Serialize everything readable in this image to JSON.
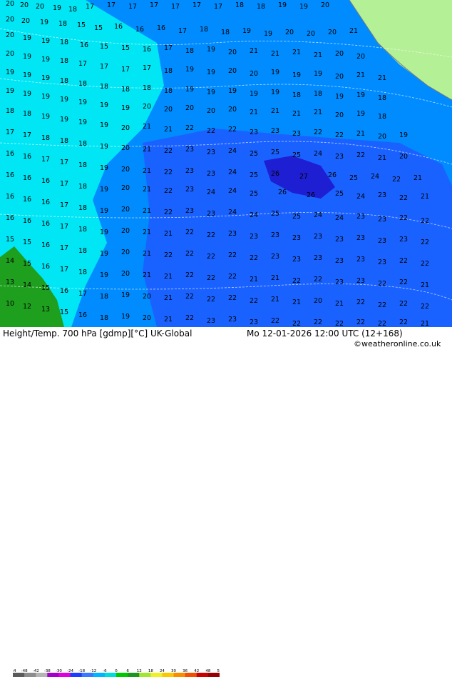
{
  "header": {
    "title": "Height/Temp. 700 hPa [gdmp][°C] UK-Global",
    "datetime": "Mo 12-01-2026 12:00 UTC (12+168)",
    "credit": "©weatheronline.co.uk"
  },
  "colorbar": {
    "ticks": [
      "-54",
      "-48",
      "-42",
      "-38",
      "-30",
      "-24",
      "-18",
      "-12",
      "-6",
      "0",
      "6",
      "12",
      "18",
      "24",
      "30",
      "36",
      "42",
      "48",
      "54"
    ],
    "colors": [
      "#5a5a5a",
      "#8c8c8c",
      "#b4b4b4",
      "#a000c8",
      "#dc00dc",
      "#1e3cff",
      "#3c78ff",
      "#00b4ff",
      "#00dcdc",
      "#00c800",
      "#1e961e",
      "#a0e632",
      "#f0f028",
      "#fac800",
      "#fa8c00",
      "#f05000",
      "#c80000",
      "#960000"
    ]
  },
  "map": {
    "colors": {
      "land_green": "#b4f096",
      "ocean_cyan": "#00e6f5",
      "mid_blue": "#008cff",
      "deep_blue": "#1e5aff",
      "core_blue": "#1e1ed2",
      "cold_green": "#1ea01e",
      "coast_gray": "#7a7a7a"
    },
    "labels": [
      [
        "20",
        8,
        8
      ],
      [
        "20",
        28,
        10
      ],
      [
        "20",
        50,
        12
      ],
      [
        "19",
        74,
        14
      ],
      [
        "18",
        96,
        16
      ],
      [
        "17",
        120,
        12
      ],
      [
        "17",
        150,
        10
      ],
      [
        "17",
        180,
        12
      ],
      [
        "17",
        210,
        10
      ],
      [
        "17",
        240,
        12
      ],
      [
        "17",
        270,
        10
      ],
      [
        "17",
        300,
        12
      ],
      [
        "18",
        330,
        10
      ],
      [
        "18",
        360,
        12
      ],
      [
        "19",
        390,
        10
      ],
      [
        "19",
        420,
        12
      ],
      [
        "20",
        450,
        10
      ],
      [
        "20",
        8,
        30
      ],
      [
        "20",
        30,
        32
      ],
      [
        "19",
        56,
        34
      ],
      [
        "18",
        82,
        36
      ],
      [
        "15",
        108,
        38
      ],
      [
        "15",
        132,
        42
      ],
      [
        "16",
        160,
        40
      ],
      [
        "16",
        190,
        44
      ],
      [
        "16",
        220,
        42
      ],
      [
        "17",
        250,
        46
      ],
      [
        "18",
        280,
        44
      ],
      [
        "18",
        310,
        48
      ],
      [
        "19",
        340,
        46
      ],
      [
        "19",
        370,
        50
      ],
      [
        "20",
        400,
        48
      ],
      [
        "20",
        430,
        50
      ],
      [
        "20",
        460,
        48
      ],
      [
        "21",
        490,
        46
      ],
      [
        "20",
        8,
        52
      ],
      [
        "19",
        32,
        56
      ],
      [
        "19",
        58,
        60
      ],
      [
        "18",
        84,
        62
      ],
      [
        "16",
        112,
        66
      ],
      [
        "15",
        140,
        68
      ],
      [
        "15",
        170,
        70
      ],
      [
        "16",
        200,
        72
      ],
      [
        "17",
        230,
        70
      ],
      [
        "18",
        260,
        74
      ],
      [
        "19",
        290,
        72
      ],
      [
        "20",
        320,
        76
      ],
      [
        "21",
        350,
        74
      ],
      [
        "21",
        380,
        78
      ],
      [
        "21",
        410,
        76
      ],
      [
        "21",
        440,
        80
      ],
      [
        "20",
        470,
        78
      ],
      [
        "20",
        500,
        82
      ],
      [
        "20",
        8,
        78
      ],
      [
        "19",
        32,
        82
      ],
      [
        "19",
        58,
        86
      ],
      [
        "18",
        84,
        88
      ],
      [
        "17",
        110,
        92
      ],
      [
        "17",
        140,
        96
      ],
      [
        "17",
        170,
        100
      ],
      [
        "17",
        200,
        98
      ],
      [
        "18",
        230,
        102
      ],
      [
        "19",
        260,
        100
      ],
      [
        "19",
        290,
        104
      ],
      [
        "20",
        320,
        102
      ],
      [
        "20",
        350,
        106
      ],
      [
        "19",
        380,
        104
      ],
      [
        "19",
        410,
        108
      ],
      [
        "19",
        440,
        106
      ],
      [
        "20",
        470,
        110
      ],
      [
        "21",
        500,
        108
      ],
      [
        "21",
        530,
        112
      ],
      [
        "19",
        8,
        104
      ],
      [
        "19",
        32,
        108
      ],
      [
        "19",
        58,
        112
      ],
      [
        "18",
        84,
        116
      ],
      [
        "18",
        110,
        120
      ],
      [
        "18",
        140,
        124
      ],
      [
        "18",
        170,
        128
      ],
      [
        "18",
        200,
        126
      ],
      [
        "18",
        230,
        130
      ],
      [
        "19",
        260,
        128
      ],
      [
        "19",
        290,
        132
      ],
      [
        "19",
        320,
        130
      ],
      [
        "19",
        350,
        134
      ],
      [
        "19",
        380,
        132
      ],
      [
        "18",
        410,
        136
      ],
      [
        "18",
        440,
        134
      ],
      [
        "19",
        470,
        138
      ],
      [
        "19",
        500,
        136
      ],
      [
        "18",
        530,
        140
      ],
      [
        "19",
        8,
        130
      ],
      [
        "19",
        32,
        134
      ],
      [
        "19",
        58,
        138
      ],
      [
        "19",
        84,
        142
      ],
      [
        "19",
        110,
        146
      ],
      [
        "19",
        140,
        150
      ],
      [
        "19",
        170,
        154
      ],
      [
        "20",
        200,
        152
      ],
      [
        "20",
        230,
        156
      ],
      [
        "20",
        260,
        154
      ],
      [
        "20",
        290,
        158
      ],
      [
        "20",
        320,
        156
      ],
      [
        "21",
        350,
        160
      ],
      [
        "21",
        380,
        158
      ],
      [
        "21",
        410,
        162
      ],
      [
        "21",
        440,
        160
      ],
      [
        "20",
        470,
        164
      ],
      [
        "19",
        500,
        162
      ],
      [
        "18",
        530,
        166
      ],
      [
        "18",
        8,
        158
      ],
      [
        "18",
        32,
        162
      ],
      [
        "19",
        58,
        166
      ],
      [
        "19",
        84,
        170
      ],
      [
        "19",
        110,
        174
      ],
      [
        "19",
        140,
        178
      ],
      [
        "20",
        170,
        182
      ],
      [
        "21",
        200,
        180
      ],
      [
        "21",
        230,
        184
      ],
      [
        "22",
        260,
        182
      ],
      [
        "22",
        290,
        186
      ],
      [
        "22",
        320,
        184
      ],
      [
        "23",
        350,
        188
      ],
      [
        "23",
        380,
        186
      ],
      [
        "23",
        410,
        190
      ],
      [
        "22",
        440,
        188
      ],
      [
        "22",
        470,
        192
      ],
      [
        "21",
        500,
        190
      ],
      [
        "20",
        530,
        194
      ],
      [
        "19",
        560,
        192
      ],
      [
        "17",
        8,
        188
      ],
      [
        "17",
        32,
        192
      ],
      [
        "18",
        58,
        196
      ],
      [
        "18",
        84,
        200
      ],
      [
        "18",
        110,
        204
      ],
      [
        "19",
        140,
        208
      ],
      [
        "20",
        170,
        210
      ],
      [
        "21",
        200,
        212
      ],
      [
        "22",
        230,
        214
      ],
      [
        "23",
        260,
        212
      ],
      [
        "23",
        290,
        216
      ],
      [
        "24",
        320,
        214
      ],
      [
        "25",
        350,
        218
      ],
      [
        "25",
        380,
        216
      ],
      [
        "25",
        410,
        220
      ],
      [
        "24",
        440,
        218
      ],
      [
        "23",
        470,
        222
      ],
      [
        "22",
        500,
        220
      ],
      [
        "21",
        530,
        224
      ],
      [
        "20",
        560,
        222
      ],
      [
        "16",
        8,
        218
      ],
      [
        "16",
        32,
        222
      ],
      [
        "17",
        58,
        226
      ],
      [
        "17",
        84,
        230
      ],
      [
        "18",
        110,
        234
      ],
      [
        "19",
        140,
        238
      ],
      [
        "20",
        170,
        240
      ],
      [
        "21",
        200,
        242
      ],
      [
        "22",
        230,
        244
      ],
      [
        "23",
        260,
        242
      ],
      [
        "23",
        290,
        246
      ],
      [
        "24",
        320,
        244
      ],
      [
        "25",
        350,
        248
      ],
      [
        "26",
        380,
        246
      ],
      [
        "27",
        420,
        250
      ],
      [
        "26",
        460,
        248
      ],
      [
        "25",
        490,
        252
      ],
      [
        "24",
        520,
        250
      ],
      [
        "22",
        550,
        254
      ],
      [
        "21",
        580,
        252
      ],
      [
        "16",
        8,
        248
      ],
      [
        "16",
        32,
        252
      ],
      [
        "16",
        58,
        256
      ],
      [
        "17",
        84,
        260
      ],
      [
        "18",
        110,
        264
      ],
      [
        "19",
        140,
        268
      ],
      [
        "20",
        170,
        266
      ],
      [
        "21",
        200,
        268
      ],
      [
        "22",
        230,
        270
      ],
      [
        "23",
        260,
        268
      ],
      [
        "24",
        290,
        272
      ],
      [
        "24",
        320,
        270
      ],
      [
        "25",
        350,
        274
      ],
      [
        "26",
        390,
        272
      ],
      [
        "26",
        430,
        276
      ],
      [
        "25",
        470,
        274
      ],
      [
        "24",
        500,
        278
      ],
      [
        "23",
        530,
        276
      ],
      [
        "22",
        560,
        280
      ],
      [
        "21",
        590,
        278
      ],
      [
        "16",
        8,
        278
      ],
      [
        "16",
        32,
        282
      ],
      [
        "16",
        58,
        286
      ],
      [
        "17",
        84,
        290
      ],
      [
        "18",
        110,
        294
      ],
      [
        "19",
        140,
        298
      ],
      [
        "20",
        170,
        296
      ],
      [
        "21",
        200,
        298
      ],
      [
        "22",
        230,
        300
      ],
      [
        "23",
        260,
        298
      ],
      [
        "23",
        290,
        302
      ],
      [
        "24",
        320,
        300
      ],
      [
        "24",
        350,
        304
      ],
      [
        "25",
        380,
        302
      ],
      [
        "25",
        410,
        306
      ],
      [
        "24",
        440,
        304
      ],
      [
        "24",
        470,
        308
      ],
      [
        "23",
        500,
        306
      ],
      [
        "23",
        530,
        310
      ],
      [
        "22",
        560,
        308
      ],
      [
        "22",
        590,
        312
      ],
      [
        "16",
        8,
        308
      ],
      [
        "16",
        32,
        312
      ],
      [
        "16",
        58,
        316
      ],
      [
        "17",
        84,
        320
      ],
      [
        "18",
        110,
        324
      ],
      [
        "19",
        140,
        328
      ],
      [
        "20",
        170,
        326
      ],
      [
        "21",
        200,
        328
      ],
      [
        "21",
        230,
        330
      ],
      [
        "22",
        260,
        328
      ],
      [
        "22",
        290,
        332
      ],
      [
        "23",
        320,
        330
      ],
      [
        "23",
        350,
        334
      ],
      [
        "23",
        380,
        332
      ],
      [
        "23",
        410,
        336
      ],
      [
        "23",
        440,
        334
      ],
      [
        "23",
        470,
        338
      ],
      [
        "23",
        500,
        336
      ],
      [
        "23",
        530,
        340
      ],
      [
        "23",
        560,
        338
      ],
      [
        "22",
        590,
        342
      ],
      [
        "15",
        8,
        338
      ],
      [
        "15",
        32,
        342
      ],
      [
        "16",
        58,
        346
      ],
      [
        "17",
        84,
        350
      ],
      [
        "18",
        110,
        354
      ],
      [
        "19",
        140,
        358
      ],
      [
        "20",
        170,
        356
      ],
      [
        "21",
        200,
        358
      ],
      [
        "22",
        230,
        360
      ],
      [
        "22",
        260,
        358
      ],
      [
        "22",
        290,
        362
      ],
      [
        "22",
        320,
        360
      ],
      [
        "22",
        350,
        364
      ],
      [
        "23",
        380,
        362
      ],
      [
        "23",
        410,
        366
      ],
      [
        "23",
        440,
        364
      ],
      [
        "23",
        470,
        368
      ],
      [
        "23",
        500,
        366
      ],
      [
        "23",
        530,
        370
      ],
      [
        "22",
        560,
        368
      ],
      [
        "22",
        590,
        372
      ],
      [
        "14",
        8,
        368
      ],
      [
        "15",
        32,
        372
      ],
      [
        "16",
        58,
        376
      ],
      [
        "17",
        84,
        380
      ],
      [
        "18",
        110,
        384
      ],
      [
        "19",
        140,
        388
      ],
      [
        "20",
        170,
        386
      ],
      [
        "21",
        200,
        388
      ],
      [
        "21",
        230,
        390
      ],
      [
        "22",
        260,
        388
      ],
      [
        "22",
        290,
        392
      ],
      [
        "22",
        320,
        390
      ],
      [
        "21",
        350,
        394
      ],
      [
        "21",
        380,
        392
      ],
      [
        "22",
        410,
        396
      ],
      [
        "22",
        440,
        394
      ],
      [
        "23",
        470,
        398
      ],
      [
        "23",
        500,
        396
      ],
      [
        "22",
        530,
        400
      ],
      [
        "22",
        560,
        398
      ],
      [
        "21",
        590,
        402
      ],
      [
        "13",
        8,
        398
      ],
      [
        "14",
        32,
        402
      ],
      [
        "15",
        58,
        406
      ],
      [
        "16",
        84,
        410
      ],
      [
        "17",
        110,
        414
      ],
      [
        "18",
        140,
        418
      ],
      [
        "19",
        170,
        416
      ],
      [
        "20",
        200,
        418
      ],
      [
        "21",
        230,
        420
      ],
      [
        "22",
        260,
        418
      ],
      [
        "22",
        290,
        422
      ],
      [
        "22",
        320,
        420
      ],
      [
        "22",
        350,
        424
      ],
      [
        "21",
        380,
        422
      ],
      [
        "21",
        410,
        426
      ],
      [
        "20",
        440,
        424
      ],
      [
        "21",
        470,
        428
      ],
      [
        "22",
        500,
        426
      ],
      [
        "22",
        530,
        430
      ],
      [
        "22",
        560,
        428
      ],
      [
        "22",
        590,
        432
      ],
      [
        "10",
        8,
        428
      ],
      [
        "12",
        32,
        432
      ],
      [
        "13",
        58,
        436
      ],
      [
        "15",
        84,
        440
      ],
      [
        "16",
        110,
        444
      ],
      [
        "18",
        140,
        448
      ],
      [
        "19",
        170,
        446
      ],
      [
        "20",
        200,
        448
      ],
      [
        "21",
        230,
        450
      ],
      [
        "22",
        260,
        448
      ],
      [
        "23",
        290,
        452
      ],
      [
        "23",
        320,
        450
      ],
      [
        "23",
        350,
        454
      ],
      [
        "22",
        380,
        452
      ],
      [
        "22",
        410,
        456
      ],
      [
        "22",
        440,
        454
      ],
      [
        "22",
        470,
        456
      ],
      [
        "22",
        500,
        454
      ],
      [
        "22",
        530,
        456
      ],
      [
        "22",
        560,
        454
      ],
      [
        "21",
        590,
        456
      ]
    ]
  }
}
